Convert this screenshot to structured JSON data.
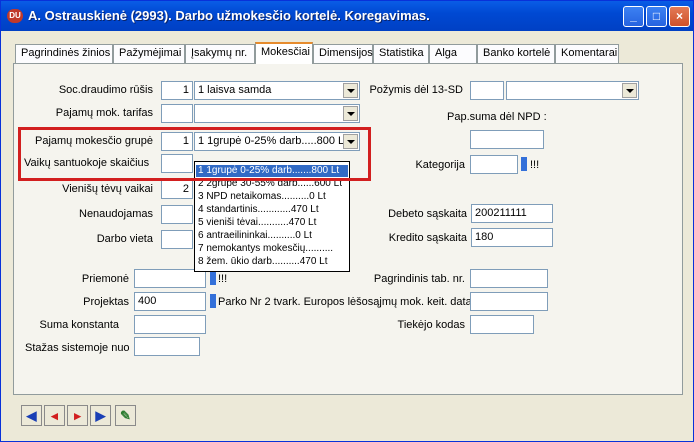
{
  "window": {
    "title": "A. Ostrauskienė  (2993).  Darbo užmokesčio kortelė. Koregavimas.",
    "icon_label": "DU",
    "controls": [
      "_",
      "□",
      "×"
    ]
  },
  "tabs": [
    {
      "label": "Pagrindinės žinios",
      "active": false
    },
    {
      "label": "Pažymėjimai",
      "active": false
    },
    {
      "label": "Įsakymų nr.",
      "active": false
    },
    {
      "label": "Mokesčiai",
      "active": true
    },
    {
      "label": "Dimensijos",
      "active": false
    },
    {
      "label": "Statistika",
      "active": false
    },
    {
      "label": "Alga",
      "active": false
    },
    {
      "label": "Banko kortelė",
      "active": false
    },
    {
      "label": "Komentarai",
      "active": false
    }
  ],
  "fields": {
    "soc_draudimo_rusis": {
      "label": "Soc.draudimo rūšis",
      "code": "1",
      "value": "1    laisva samda"
    },
    "pajamu_mok_tarifas": {
      "label": "Pajamų mok. tarifas",
      "code": "",
      "value": ""
    },
    "pajamu_mokescio_grupe": {
      "label": "Pajamų mokesčio grupė",
      "code": "1",
      "value": "1   1grupė 0-25% darb.....800 Lt"
    },
    "vaiku_santuokoje": {
      "label": "Vaikų santuokoje skaičius",
      "value": ""
    },
    "vienisu_tevu_vaikai": {
      "label": "Vienišų tėvų vaikai",
      "value": "2"
    },
    "nenaudojamas": {
      "label": "Nenaudojamas",
      "value": ""
    },
    "darbo_vieta": {
      "label": "Darbo vieta",
      "value": ""
    },
    "pozymis_13sd": {
      "label": "Požymis dėl 13-SD",
      "code": "",
      "value": ""
    },
    "pap_suma_npd": {
      "label": "Pap.suma dėl NPD :",
      "value": ""
    },
    "kategorija": {
      "label": "Kategorija",
      "value": "",
      "mark": "!!!"
    },
    "debeto_saskaita": {
      "label": "Debeto sąskaita",
      "value": "200211111"
    },
    "kredito_saskaita": {
      "label": "Kredito sąskaita",
      "value": "180"
    },
    "priemone": {
      "label": "Priemonė",
      "value": "",
      "mark": "!!!"
    },
    "projektas": {
      "label": "Projektas",
      "value": "400",
      "description": "Parko Nr 2 tvark. Europos lėšosąjmų mok. keit. data"
    },
    "suma_konstanta": {
      "label": "Suma konstanta",
      "value": ""
    },
    "stazas_sistemoje": {
      "label": "Stažas sistemoje nuo",
      "value": ""
    },
    "pagrindinis_tab_nr": {
      "label": "Pagrindinis tab. nr.",
      "value": ""
    },
    "tiekejo_kodas": {
      "label": "Tiekėjo kodas",
      "value": ""
    },
    "extra_box": {
      "value": ""
    }
  },
  "dropdown": {
    "items": [
      {
        "text": "1   1grupė 0-25% darb.......800 Lt",
        "selected": true
      },
      {
        "text": "2   2grupė 30-55% darb......600 Lt",
        "selected": false
      },
      {
        "text": "3   NPD netaikomas..........0 Lt",
        "selected": false
      },
      {
        "text": "4   standartinis............470 Lt",
        "selected": false
      },
      {
        "text": "5   vieniši tėvai...........470 Lt",
        "selected": false
      },
      {
        "text": "6   antraeilininkai..........0 Lt",
        "selected": false
      },
      {
        "text": "7   nemokantys mokesčių..........",
        "selected": false
      },
      {
        "text": "8   žem. ūkio darb..........470 Lt",
        "selected": false
      }
    ]
  },
  "nav_buttons": [
    {
      "name": "first-record-button",
      "glyph": "◀"
    },
    {
      "name": "prev-record-button",
      "glyph": "◂"
    },
    {
      "name": "next-record-button",
      "glyph": "▸"
    },
    {
      "name": "last-record-button",
      "glyph": "▶"
    },
    {
      "name": "edit-button",
      "glyph": "✎"
    }
  ],
  "colors": {
    "titlebar": "#0a5de6",
    "highlight": "#d21f1f",
    "selection": "#316ac5"
  }
}
